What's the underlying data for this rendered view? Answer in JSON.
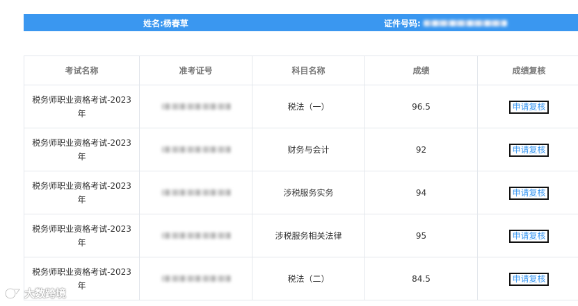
{
  "header": {
    "name_label": "姓名:杨春草",
    "id_label": "证件号码:"
  },
  "table": {
    "columns": [
      "考试名称",
      "准考证号",
      "科目名称",
      "成绩",
      "成绩复核"
    ],
    "rows": [
      {
        "exam": "税务师职业资格考试-2023年",
        "subject": "税法（一）",
        "score": "96.5",
        "action": "申请复核"
      },
      {
        "exam": "税务师职业资格考试-2023年",
        "subject": "财务与会计",
        "score": "92",
        "action": "申请复核"
      },
      {
        "exam": "税务师职业资格考试-2023年",
        "subject": "涉税服务实务",
        "score": "94",
        "action": "申请复核"
      },
      {
        "exam": "税务师职业资格考试-2023年",
        "subject": "涉税服务相关法律",
        "score": "95",
        "action": "申请复核"
      },
      {
        "exam": "税务师职业资格考试-2023年",
        "subject": "税法（二）",
        "score": "84.5",
        "action": "申请复核"
      }
    ]
  },
  "watermark": {
    "text": "大数跨境"
  },
  "colors": {
    "accent": "#3a97f0",
    "border": "#e3e7ec",
    "header_text": "#777777"
  }
}
